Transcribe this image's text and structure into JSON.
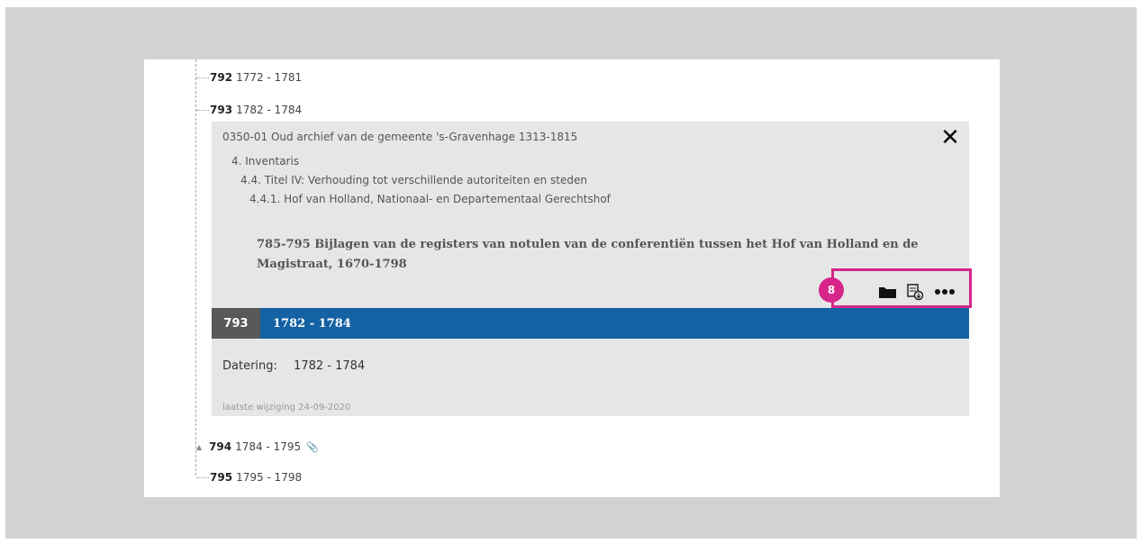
{
  "tree": {
    "rows": [
      {
        "number": "792",
        "range": "1772 - 1781"
      },
      {
        "number": "793",
        "range": "1782 - 1784"
      },
      {
        "number": "794",
        "range": "1784 - 1795",
        "has_attachment": true
      },
      {
        "number": "795",
        "range": "1795 - 1798"
      }
    ]
  },
  "panel": {
    "archive": "0350-01 Oud archief van de gemeente 's-Gravenhage 1313-1815",
    "breadcrumbs": [
      "4. Inventaris",
      "4.4. Titel IV: Verhouding tot verschillende autoriteiten en steden",
      "4.4.1. Hof van Holland, Nationaal- en Departementaal Gerechtshof"
    ],
    "series_title": "785-795 Bijlagen van de registers van notulen van de conferentiën tussen het Hof van Holland en de Magistraat, 1670-1798",
    "badge": "8",
    "icons": [
      "folder-icon",
      "scan-icon",
      "more-icon",
      "close-icon",
      "paperclip-icon"
    ],
    "item": {
      "number": "793",
      "title": "1782 - 1784",
      "datering_label": "Datering:",
      "datering_value": "1782 - 1784",
      "last_modified": "laatste wijziging 24-09-2020"
    },
    "colors": {
      "accent": "#1462a3",
      "highlight": "#d8258a",
      "number_bg": "#595959"
    }
  }
}
